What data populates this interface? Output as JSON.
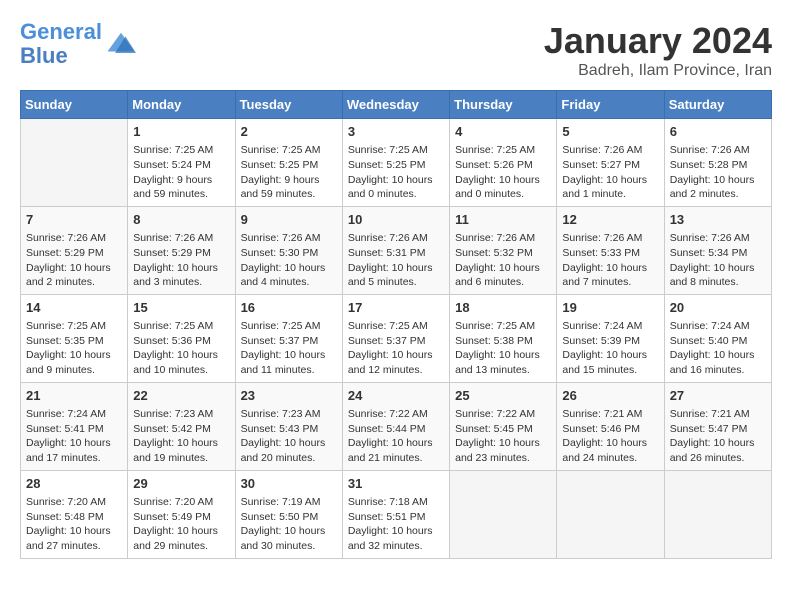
{
  "header": {
    "logo_line1": "General",
    "logo_line2": "Blue",
    "title": "January 2024",
    "subtitle": "Badreh, Ilam Province, Iran"
  },
  "weekdays": [
    "Sunday",
    "Monday",
    "Tuesday",
    "Wednesday",
    "Thursday",
    "Friday",
    "Saturday"
  ],
  "weeks": [
    [
      {
        "day": "",
        "info": ""
      },
      {
        "day": "1",
        "info": "Sunrise: 7:25 AM\nSunset: 5:24 PM\nDaylight: 9 hours\nand 59 minutes."
      },
      {
        "day": "2",
        "info": "Sunrise: 7:25 AM\nSunset: 5:25 PM\nDaylight: 9 hours\nand 59 minutes."
      },
      {
        "day": "3",
        "info": "Sunrise: 7:25 AM\nSunset: 5:25 PM\nDaylight: 10 hours\nand 0 minutes."
      },
      {
        "day": "4",
        "info": "Sunrise: 7:25 AM\nSunset: 5:26 PM\nDaylight: 10 hours\nand 0 minutes."
      },
      {
        "day": "5",
        "info": "Sunrise: 7:26 AM\nSunset: 5:27 PM\nDaylight: 10 hours\nand 1 minute."
      },
      {
        "day": "6",
        "info": "Sunrise: 7:26 AM\nSunset: 5:28 PM\nDaylight: 10 hours\nand 2 minutes."
      }
    ],
    [
      {
        "day": "7",
        "info": "Sunrise: 7:26 AM\nSunset: 5:29 PM\nDaylight: 10 hours\nand 2 minutes."
      },
      {
        "day": "8",
        "info": "Sunrise: 7:26 AM\nSunset: 5:29 PM\nDaylight: 10 hours\nand 3 minutes."
      },
      {
        "day": "9",
        "info": "Sunrise: 7:26 AM\nSunset: 5:30 PM\nDaylight: 10 hours\nand 4 minutes."
      },
      {
        "day": "10",
        "info": "Sunrise: 7:26 AM\nSunset: 5:31 PM\nDaylight: 10 hours\nand 5 minutes."
      },
      {
        "day": "11",
        "info": "Sunrise: 7:26 AM\nSunset: 5:32 PM\nDaylight: 10 hours\nand 6 minutes."
      },
      {
        "day": "12",
        "info": "Sunrise: 7:26 AM\nSunset: 5:33 PM\nDaylight: 10 hours\nand 7 minutes."
      },
      {
        "day": "13",
        "info": "Sunrise: 7:26 AM\nSunset: 5:34 PM\nDaylight: 10 hours\nand 8 minutes."
      }
    ],
    [
      {
        "day": "14",
        "info": "Sunrise: 7:25 AM\nSunset: 5:35 PM\nDaylight: 10 hours\nand 9 minutes."
      },
      {
        "day": "15",
        "info": "Sunrise: 7:25 AM\nSunset: 5:36 PM\nDaylight: 10 hours\nand 10 minutes."
      },
      {
        "day": "16",
        "info": "Sunrise: 7:25 AM\nSunset: 5:37 PM\nDaylight: 10 hours\nand 11 minutes."
      },
      {
        "day": "17",
        "info": "Sunrise: 7:25 AM\nSunset: 5:37 PM\nDaylight: 10 hours\nand 12 minutes."
      },
      {
        "day": "18",
        "info": "Sunrise: 7:25 AM\nSunset: 5:38 PM\nDaylight: 10 hours\nand 13 minutes."
      },
      {
        "day": "19",
        "info": "Sunrise: 7:24 AM\nSunset: 5:39 PM\nDaylight: 10 hours\nand 15 minutes."
      },
      {
        "day": "20",
        "info": "Sunrise: 7:24 AM\nSunset: 5:40 PM\nDaylight: 10 hours\nand 16 minutes."
      }
    ],
    [
      {
        "day": "21",
        "info": "Sunrise: 7:24 AM\nSunset: 5:41 PM\nDaylight: 10 hours\nand 17 minutes."
      },
      {
        "day": "22",
        "info": "Sunrise: 7:23 AM\nSunset: 5:42 PM\nDaylight: 10 hours\nand 19 minutes."
      },
      {
        "day": "23",
        "info": "Sunrise: 7:23 AM\nSunset: 5:43 PM\nDaylight: 10 hours\nand 20 minutes."
      },
      {
        "day": "24",
        "info": "Sunrise: 7:22 AM\nSunset: 5:44 PM\nDaylight: 10 hours\nand 21 minutes."
      },
      {
        "day": "25",
        "info": "Sunrise: 7:22 AM\nSunset: 5:45 PM\nDaylight: 10 hours\nand 23 minutes."
      },
      {
        "day": "26",
        "info": "Sunrise: 7:21 AM\nSunset: 5:46 PM\nDaylight: 10 hours\nand 24 minutes."
      },
      {
        "day": "27",
        "info": "Sunrise: 7:21 AM\nSunset: 5:47 PM\nDaylight: 10 hours\nand 26 minutes."
      }
    ],
    [
      {
        "day": "28",
        "info": "Sunrise: 7:20 AM\nSunset: 5:48 PM\nDaylight: 10 hours\nand 27 minutes."
      },
      {
        "day": "29",
        "info": "Sunrise: 7:20 AM\nSunset: 5:49 PM\nDaylight: 10 hours\nand 29 minutes."
      },
      {
        "day": "30",
        "info": "Sunrise: 7:19 AM\nSunset: 5:50 PM\nDaylight: 10 hours\nand 30 minutes."
      },
      {
        "day": "31",
        "info": "Sunrise: 7:18 AM\nSunset: 5:51 PM\nDaylight: 10 hours\nand 32 minutes."
      },
      {
        "day": "",
        "info": ""
      },
      {
        "day": "",
        "info": ""
      },
      {
        "day": "",
        "info": ""
      }
    ]
  ]
}
